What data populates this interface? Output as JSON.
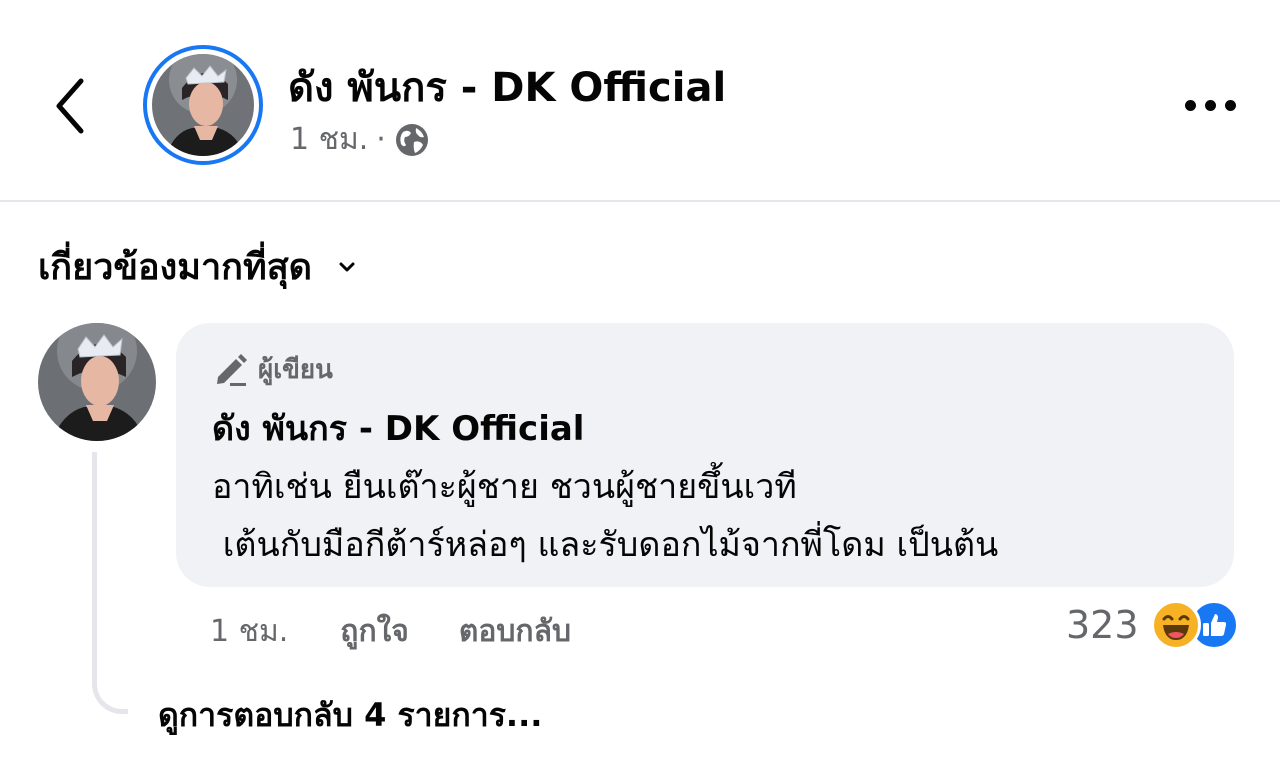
{
  "header": {
    "page_name": "ดัง พันกร - DK Official",
    "time": "1 ชม.",
    "separator": "·",
    "audience_icon": "globe-icon",
    "back_icon": "chevron-left-icon",
    "more_icon": "more-horizontal-icon"
  },
  "sort": {
    "label": "เกี่ยวข้องมากที่สุด",
    "icon": "chevron-down-icon"
  },
  "comment": {
    "badge_icon": "pencil-icon",
    "badge_label": "ผู้เขียน",
    "author": "ดัง พันกร - DK Official",
    "text_line1": "อาทิเช่น ยืนเต๊าะผู้ชาย ชวนผู้ชายขึ้นเวที",
    "text_line2": " เต้นกับมือกีต้าร์หล่อๆ และรับดอกไม้จากพี่โดม เป็นต้น",
    "time": "1 ชม.",
    "like_label": "ถูกใจ",
    "reply_label": "ตอบกลับ",
    "reaction_count": "323",
    "reaction_icons": [
      "haha-icon",
      "like-icon"
    ]
  },
  "replies": {
    "label": "ดูการตอบกลับ 4 รายการ..."
  },
  "colors": {
    "accent": "#1877f2",
    "bubble": "#f0f2f5",
    "secondary_text": "#65676b",
    "haha": "#f7b125"
  }
}
